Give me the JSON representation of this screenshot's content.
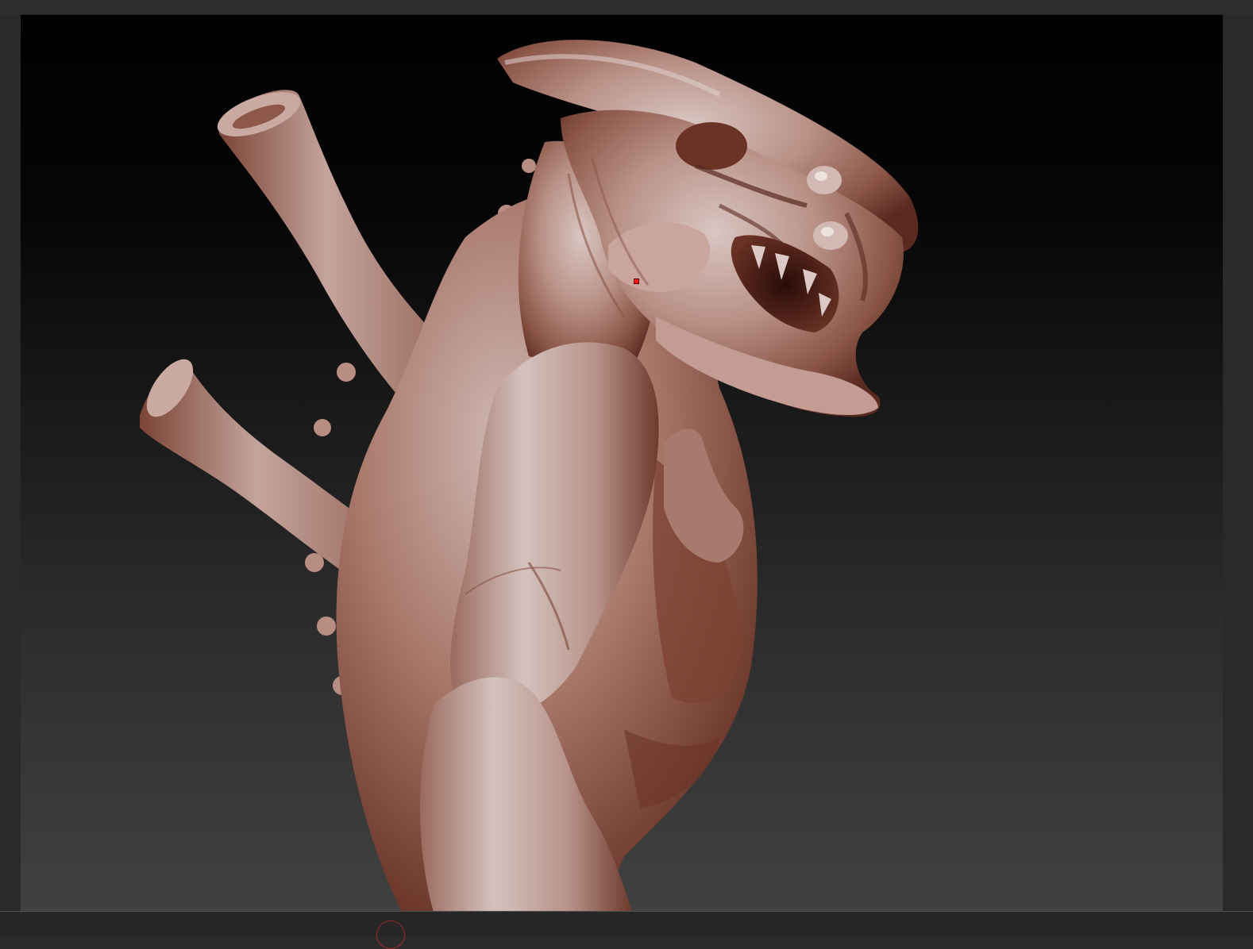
{
  "app": {
    "type": "3d-sculpting-viewport"
  },
  "viewport": {
    "background_top": "#000000",
    "background_bottom": "#414141",
    "model": {
      "subject": "alien-creature-bust-sculpt",
      "material_color": "#b98a7c",
      "material_shadow": "#5a2a20",
      "material_highlight": "#d8c4c0"
    },
    "cursor_color": "#ff1a1a"
  },
  "bottom_bar": {
    "brush_indicator_color": "#9a2a2a"
  }
}
